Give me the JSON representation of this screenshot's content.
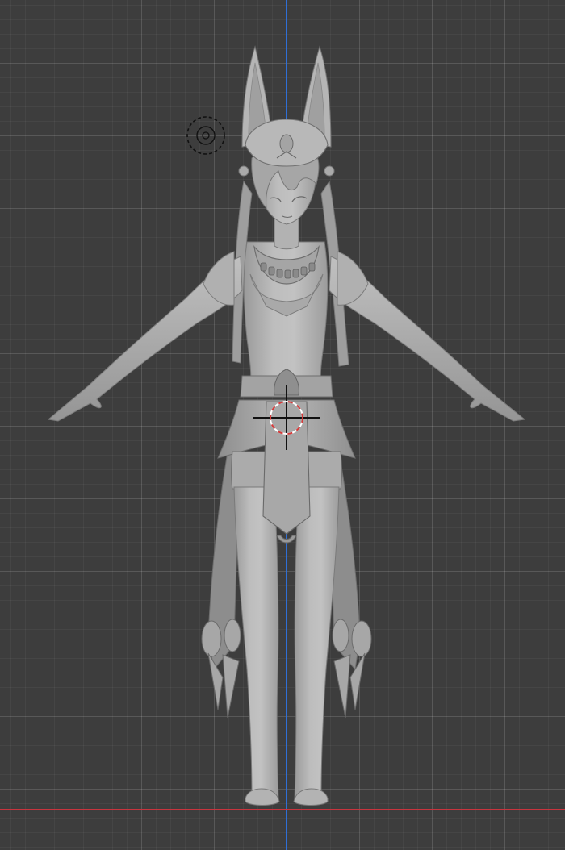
{
  "viewport": {
    "view": "front-orthographic",
    "background_color": "#3d3d3d",
    "grid_line_color": "#4a4a4a"
  },
  "axes": {
    "z_axis_color": "#2f6fd6",
    "x_axis_color": "#c8343e"
  },
  "model": {
    "shading": "solid",
    "color": "#b4b4b4",
    "pose": "T-pose"
  },
  "gizmos": {
    "light_icon": "light-point-icon",
    "cursor_icon": "3d-cursor-icon",
    "cursor_ring_colors": [
      "#d63a3a",
      "#ffffff"
    ]
  }
}
